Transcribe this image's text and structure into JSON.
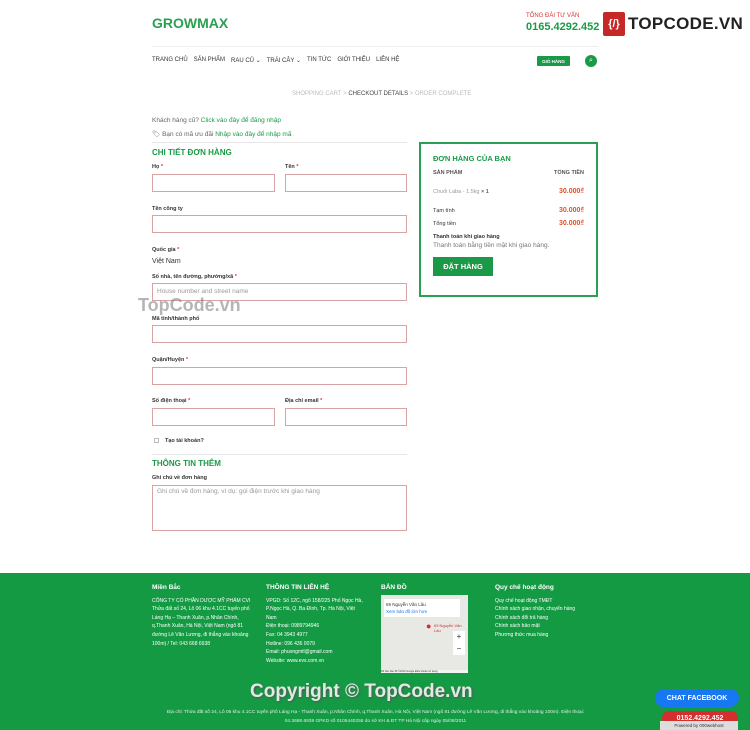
{
  "header": {
    "logo": "GROWMAX",
    "hotline_label": "TỔNG ĐÀI TƯ VẤN",
    "hotline": "0165.4292.452",
    "brand_logo": "TOPCODE.VN"
  },
  "nav": {
    "items": [
      "TRANG CHỦ",
      "SẢN PHẨM",
      "RAU CỦ ⌄",
      "TRÁI CÂY ⌄",
      "TIN TỨC",
      "GIỚI THIỆU",
      "LIÊN HỆ"
    ],
    "cart": "GIỎ HÀNG"
  },
  "breadcrumb": {
    "step1": "SHOPPING CART",
    "sep": ">",
    "step2": "CHECKOUT DETAILS",
    "step3": "ORDER COMPLETE"
  },
  "notices": {
    "login_prefix": "Khách hàng cũ?",
    "login_link": "Click vào đây để đăng nhập",
    "coupon_prefix": "Bạn có mã ưu đãi",
    "coupon_link": "Nhập vào đây để nhập mã"
  },
  "billing": {
    "title": "CHI TIẾT ĐƠN HÀNG",
    "first_name": "Họ",
    "last_name": "Tên",
    "company": "Tên công ty",
    "country": "Quốc gia",
    "country_value": "Việt Nam",
    "address": "Số nhà, tên đường, phường/xã",
    "address_placeholder": "House number and street name",
    "city": "Mã tỉnh/thành phố",
    "district": "Quận/Huyện",
    "phone": "Số điện thoại",
    "email": "Địa chỉ email",
    "create_account": "Tạo tài khoản?",
    "req": "*"
  },
  "additional": {
    "title": "THÔNG TIN THÊM",
    "notes_label": "Ghi chú về đơn hàng",
    "notes_placeholder": "Ghi chú về đơn hàng, ví dụ: gọi điện trước khi giao hàng"
  },
  "order": {
    "title": "ĐƠN HÀNG CỦA BẠN",
    "col_product": "SẢN PHẨM",
    "col_total": "TỔNG TIỀN",
    "item": "Chuối Laba - 1.5kg",
    "qty": "× 1",
    "item_price": "30.000₫",
    "subtotal_label": "Tạm tính",
    "subtotal": "30.000₫",
    "total_label": "Tổng tiền",
    "total": "30.000₫",
    "payment_title": "Thanh toán khi giao hàng",
    "payment_desc": "Thanh toán bằng tiền mặt khi giao hàng.",
    "place_order": "ĐẶT HÀNG"
  },
  "footer": {
    "col1": {
      "title": "Miền Bắc",
      "lines": [
        "CÔNG TY CỔ PHẦN DƯỢC MỸ PHẨM CVI",
        "Thửa đất số 24, Lô 06 khu 4.1CC tuyến phố Láng Hạ – Thanh Xuân, p.Nhân Chính, q.Thanh Xuân, Hà Nội, Việt Nam (ngõ 81 đường Lê Văn Lương, đi thẳng vào khoảng 100m) / Tel: 043 668 6938"
      ]
    },
    "col2": {
      "title": "THÔNG TIN LIÊN HỆ",
      "lines": [
        "VPGD: Số 12C, ngõ 158/225 Phố Ngọc Hà, P.Ngọc Hà, Q. Ba Đình, Tp. Hà Nội, Việt Nam",
        "Điện thoại: 0989794946",
        "Fax: 04 3943 4977",
        "Hotline: 096 436 0079",
        "Email: phuongmtl@gmail.com",
        "Website: www.evs.com.vn"
      ]
    },
    "col3": {
      "title": "BẢN ĐỒ",
      "map_place": "69 Nguyễn Văn Lâu",
      "map_link": "Xem bản đồ lớn hơn",
      "map_pin": "69 Nguyễn Văn Lâu",
      "map_credit": "Dữ liệu bản đồ ©2019 Google  Điều khoản sử dụng"
    },
    "col4": {
      "title": "Quy chế hoạt động",
      "links": [
        "Quy chế hoạt động TMĐT",
        "Chính sách giao nhận, chuyển hàng",
        "Chính sách đổi trả hàng",
        "Chính sách bảo mật",
        "Phương thức mua hàng"
      ]
    },
    "address_line": "Địa chỉ: Thửa đất số 24, Lô 06 khu 4.1CC tuyến phố Láng Hạ - Thanh Xuân, p.Nhân Chính, q.Thanh Xuân, Hà Nội, Việt Nam (ngõ 81 đường Lê Văn Lương, đi thẳng vào khoảng 100m). Điện thoại: 04.3668.6938 GPKD số 0105440255 do sở KH & ĐT TP Hà Nội cấp ngày 05/08/2011"
  },
  "watermark": "TopCode.vn",
  "copyright": "Copyright © TopCode.vn",
  "floating": {
    "chat": "CHAT FACEBOOK",
    "phone": "0152.4292.452",
    "powered": "Powered by 000webhost"
  },
  "colors": {
    "primary": "#1a9a47",
    "price": "#e0502b",
    "footer": "#159a44"
  }
}
